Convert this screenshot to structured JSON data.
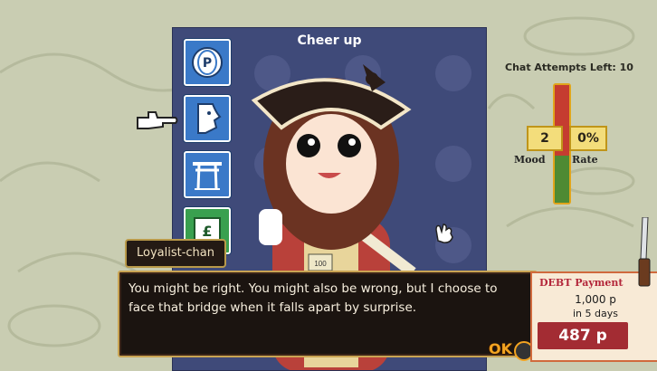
{
  "panel": {
    "title": "Cheer up"
  },
  "sidebar": {
    "items": [
      {
        "icon": "coin-p-icon"
      },
      {
        "icon": "face-profile-icon"
      },
      {
        "icon": "torii-gate-icon"
      },
      {
        "icon": "money-bag-icon"
      }
    ]
  },
  "character": {
    "name": "Loyalist-chan",
    "badge": "100"
  },
  "dialog": {
    "line1": "You might be right. You might also be wrong, but I choose to",
    "line2": "face that bridge when it falls apart by surprise.",
    "ok_label": "OK"
  },
  "stats": {
    "chat_attempts_label": "Chat Attempts Left: 10",
    "mood_value": "2",
    "rate_value": "0%",
    "mood_label": "Mood",
    "rate_label": "Rate",
    "meter_level": 0.4
  },
  "payment": {
    "title": "DEBT Payment",
    "amount": "1,000 p",
    "due": "in 5 days",
    "balance": "487 p"
  },
  "colors": {
    "panel": "#3f4a79",
    "accent": "#e0a51c",
    "money": "#a32c33"
  }
}
